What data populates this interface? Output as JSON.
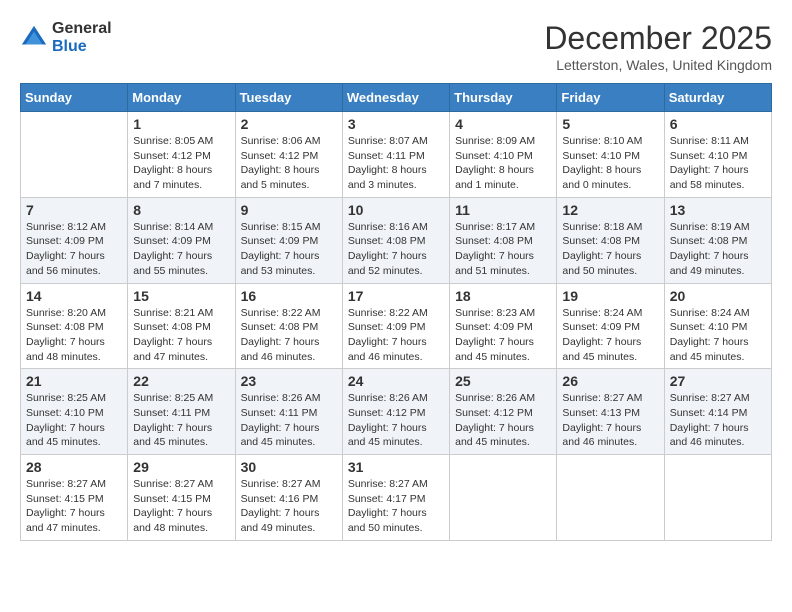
{
  "logo": {
    "general": "General",
    "blue": "Blue"
  },
  "title": "December 2025",
  "location": "Letterston, Wales, United Kingdom",
  "days_of_week": [
    "Sunday",
    "Monday",
    "Tuesday",
    "Wednesday",
    "Thursday",
    "Friday",
    "Saturday"
  ],
  "weeks": [
    [
      {
        "day": "",
        "info": ""
      },
      {
        "day": "1",
        "info": "Sunrise: 8:05 AM\nSunset: 4:12 PM\nDaylight: 8 hours\nand 7 minutes."
      },
      {
        "day": "2",
        "info": "Sunrise: 8:06 AM\nSunset: 4:12 PM\nDaylight: 8 hours\nand 5 minutes."
      },
      {
        "day": "3",
        "info": "Sunrise: 8:07 AM\nSunset: 4:11 PM\nDaylight: 8 hours\nand 3 minutes."
      },
      {
        "day": "4",
        "info": "Sunrise: 8:09 AM\nSunset: 4:10 PM\nDaylight: 8 hours\nand 1 minute."
      },
      {
        "day": "5",
        "info": "Sunrise: 8:10 AM\nSunset: 4:10 PM\nDaylight: 8 hours\nand 0 minutes."
      },
      {
        "day": "6",
        "info": "Sunrise: 8:11 AM\nSunset: 4:10 PM\nDaylight: 7 hours\nand 58 minutes."
      }
    ],
    [
      {
        "day": "7",
        "info": "Sunrise: 8:12 AM\nSunset: 4:09 PM\nDaylight: 7 hours\nand 56 minutes."
      },
      {
        "day": "8",
        "info": "Sunrise: 8:14 AM\nSunset: 4:09 PM\nDaylight: 7 hours\nand 55 minutes."
      },
      {
        "day": "9",
        "info": "Sunrise: 8:15 AM\nSunset: 4:09 PM\nDaylight: 7 hours\nand 53 minutes."
      },
      {
        "day": "10",
        "info": "Sunrise: 8:16 AM\nSunset: 4:08 PM\nDaylight: 7 hours\nand 52 minutes."
      },
      {
        "day": "11",
        "info": "Sunrise: 8:17 AM\nSunset: 4:08 PM\nDaylight: 7 hours\nand 51 minutes."
      },
      {
        "day": "12",
        "info": "Sunrise: 8:18 AM\nSunset: 4:08 PM\nDaylight: 7 hours\nand 50 minutes."
      },
      {
        "day": "13",
        "info": "Sunrise: 8:19 AM\nSunset: 4:08 PM\nDaylight: 7 hours\nand 49 minutes."
      }
    ],
    [
      {
        "day": "14",
        "info": "Sunrise: 8:20 AM\nSunset: 4:08 PM\nDaylight: 7 hours\nand 48 minutes."
      },
      {
        "day": "15",
        "info": "Sunrise: 8:21 AM\nSunset: 4:08 PM\nDaylight: 7 hours\nand 47 minutes."
      },
      {
        "day": "16",
        "info": "Sunrise: 8:22 AM\nSunset: 4:08 PM\nDaylight: 7 hours\nand 46 minutes."
      },
      {
        "day": "17",
        "info": "Sunrise: 8:22 AM\nSunset: 4:09 PM\nDaylight: 7 hours\nand 46 minutes."
      },
      {
        "day": "18",
        "info": "Sunrise: 8:23 AM\nSunset: 4:09 PM\nDaylight: 7 hours\nand 45 minutes."
      },
      {
        "day": "19",
        "info": "Sunrise: 8:24 AM\nSunset: 4:09 PM\nDaylight: 7 hours\nand 45 minutes."
      },
      {
        "day": "20",
        "info": "Sunrise: 8:24 AM\nSunset: 4:10 PM\nDaylight: 7 hours\nand 45 minutes."
      }
    ],
    [
      {
        "day": "21",
        "info": "Sunrise: 8:25 AM\nSunset: 4:10 PM\nDaylight: 7 hours\nand 45 minutes."
      },
      {
        "day": "22",
        "info": "Sunrise: 8:25 AM\nSunset: 4:11 PM\nDaylight: 7 hours\nand 45 minutes."
      },
      {
        "day": "23",
        "info": "Sunrise: 8:26 AM\nSunset: 4:11 PM\nDaylight: 7 hours\nand 45 minutes."
      },
      {
        "day": "24",
        "info": "Sunrise: 8:26 AM\nSunset: 4:12 PM\nDaylight: 7 hours\nand 45 minutes."
      },
      {
        "day": "25",
        "info": "Sunrise: 8:26 AM\nSunset: 4:12 PM\nDaylight: 7 hours\nand 45 minutes."
      },
      {
        "day": "26",
        "info": "Sunrise: 8:27 AM\nSunset: 4:13 PM\nDaylight: 7 hours\nand 46 minutes."
      },
      {
        "day": "27",
        "info": "Sunrise: 8:27 AM\nSunset: 4:14 PM\nDaylight: 7 hours\nand 46 minutes."
      }
    ],
    [
      {
        "day": "28",
        "info": "Sunrise: 8:27 AM\nSunset: 4:15 PM\nDaylight: 7 hours\nand 47 minutes."
      },
      {
        "day": "29",
        "info": "Sunrise: 8:27 AM\nSunset: 4:15 PM\nDaylight: 7 hours\nand 48 minutes."
      },
      {
        "day": "30",
        "info": "Sunrise: 8:27 AM\nSunset: 4:16 PM\nDaylight: 7 hours\nand 49 minutes."
      },
      {
        "day": "31",
        "info": "Sunrise: 8:27 AM\nSunset: 4:17 PM\nDaylight: 7 hours\nand 50 minutes."
      },
      {
        "day": "",
        "info": ""
      },
      {
        "day": "",
        "info": ""
      },
      {
        "day": "",
        "info": ""
      }
    ]
  ]
}
